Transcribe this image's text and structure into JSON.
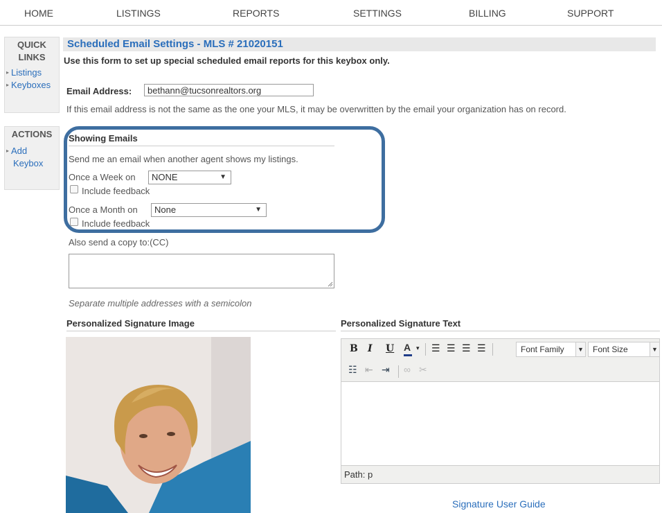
{
  "nav": [
    "HOME",
    "LISTINGS",
    "REPORTS",
    "SETTINGS",
    "BILLING",
    "SUPPORT"
  ],
  "quick_links": {
    "title_1": "QUICK",
    "title_2": "LINKS",
    "items": [
      "Listings",
      "Keyboxes"
    ]
  },
  "actions": {
    "title": "ACTIONS",
    "item_1": "Add",
    "item_2": "Keybox"
  },
  "page": {
    "title": "Scheduled Email Settings - MLS # 21020151",
    "intro": "Use this form to set up special scheduled email reports for this keybox only.",
    "email_label": "Email Address:",
    "email_value": "bethann@tucsonrealtors.org",
    "email_note": "If this email address is not the same as the one your MLS, it may be overwritten by the email your organization has on record."
  },
  "showing": {
    "heading": "Showing Emails",
    "desc": "Send me an email when another agent shows my listings.",
    "week_label": "Once a Week on",
    "week_value": "NONE",
    "month_label": "Once a Month on",
    "month_value": "None",
    "include_feedback": "Include feedback",
    "cc_label": "Also send a copy to:(CC)",
    "cc_hint": "Separate multiple addresses with a semicolon"
  },
  "signature": {
    "image_heading": "Personalized Signature Image",
    "text_heading": "Personalized Signature Text",
    "font_family": "Font Family",
    "font_size": "Font Size",
    "path_label": "Path: p",
    "guide_link": "Signature User Guide"
  },
  "colors": {
    "link": "#2a6ebb",
    "highlight": "#3e6ea0"
  }
}
